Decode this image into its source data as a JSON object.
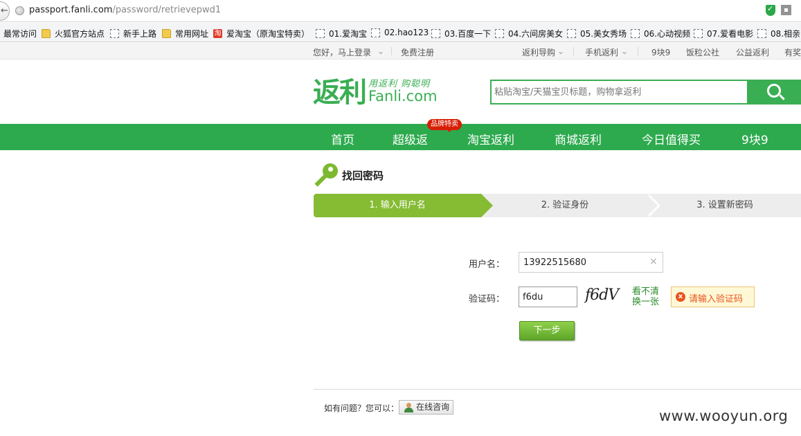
{
  "browser": {
    "url_domain": "passport.fanli.com",
    "url_path": "/password/retrievepwd1",
    "bookmarks": [
      "最常访问",
      "火狐官方站点",
      "新手上路",
      "常用网址",
      "爱淘宝（原淘宝特卖）",
      "01.爱淘宝",
      "02.hao123",
      "03.百度一下",
      "04.六间房美女",
      "05.美女秀场",
      "06.心动视频",
      "07.爱看电影",
      "08.相亲"
    ],
    "taobao_glyph": "淘"
  },
  "topnav": {
    "login": "您好，马上登录",
    "register": "免费注册",
    "guide": "返利导购",
    "mobile": "手机返利",
    "nine": "9块9",
    "community": "饭粒公社",
    "charity": "公益返利",
    "more": "有奖"
  },
  "header": {
    "logo_main": "返利",
    "logo_slogan": "用返利 购聪明",
    "logo_domain": "Fanli.com",
    "search_placeholder": "粘贴淘宝/天猫宝贝标题，购物拿返利"
  },
  "mainnav": {
    "items": [
      "首页",
      "超级返",
      "淘宝返利",
      "商城返利",
      "今日值得买",
      "9块9"
    ],
    "promo_badge": "品牌特卖"
  },
  "page": {
    "title": "找回密码",
    "steps": [
      "1. 输入用户名",
      "2. 验证身份",
      "3. 设置新密码"
    ]
  },
  "form": {
    "username_label": "用户名：",
    "username_value": "13922515680",
    "clear": "×",
    "captcha_label": "验证码：",
    "captcha_value": "f6du",
    "captcha_image_text": "f6dV",
    "refresh_line1": "看不清",
    "refresh_line2": "换一张",
    "error_icon": "x",
    "error_text": "请输入验证码",
    "next_button": "下一步"
  },
  "footer": {
    "help_text": "如有问题？您可以：",
    "consult_button": "在线咨询",
    "watermark": "www.wooyun.org"
  },
  "colors": {
    "brand_green": "#2daa4e",
    "step_active": "#86bb34",
    "error_orange": "#e8541e"
  }
}
